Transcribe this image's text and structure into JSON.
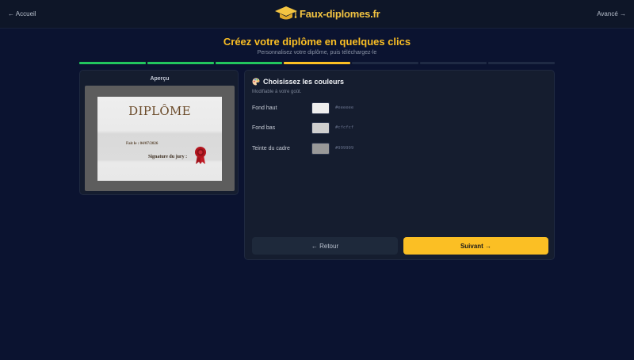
{
  "header": {
    "back_link": "← Accueil",
    "brand": "Faux-diplomes.fr",
    "advanced_link": "Avancé →"
  },
  "hero": {
    "title": "Créez votre diplôme en quelques clics",
    "subtitle": "Personnalisez votre diplôme, puis téléchargez-le"
  },
  "progress": {
    "total_steps": 7,
    "current_step": 4,
    "colors": {
      "done": "#22c55e",
      "active": "#fbbf24",
      "pending": "#1f2a44"
    }
  },
  "preview": {
    "label": "Aperçu",
    "diploma": {
      "title": "DIPLÔME",
      "date_line": "Fait le : 04/07/2026",
      "signature_line": "Signature du jury :"
    }
  },
  "colors_step": {
    "icon": "palette-icon",
    "title": "Choisissez les couleurs",
    "subtitle": "Modifiable à votre goût.",
    "fields": [
      {
        "label": "Fond haut",
        "value": "#eeeeee"
      },
      {
        "label": "Fond bas",
        "value": "#cfcfcf"
      },
      {
        "label": "Teinte du cadre",
        "value": "#999999"
      }
    ]
  },
  "actions": {
    "back_label": "← Retour",
    "next_label": "Suivant →"
  }
}
